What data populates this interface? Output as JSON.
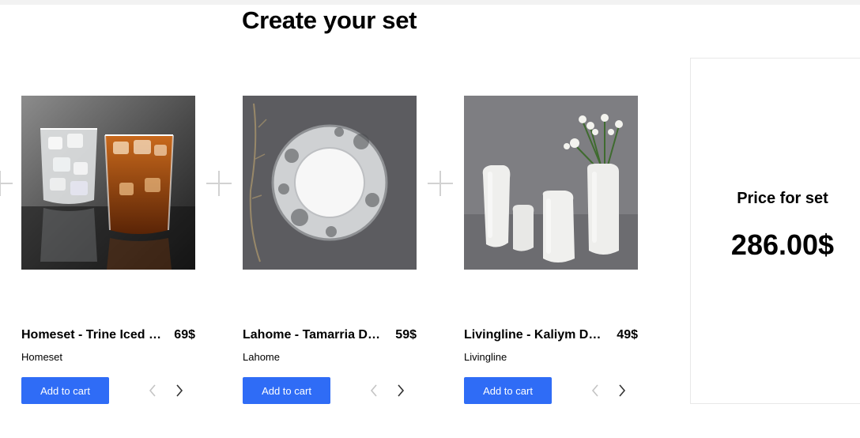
{
  "page": {
    "title": "Create your set"
  },
  "products": [
    {
      "name": "Homeset - Trine Iced …",
      "price": "69$",
      "brand": "Homeset",
      "add_to_cart": "Add to cart",
      "image_icon": "glassware-image"
    },
    {
      "name": "Lahome - Tamarria De…",
      "price": "59$",
      "brand": "Lahome",
      "add_to_cart": "Add to cart",
      "image_icon": "plate-image"
    },
    {
      "name": "Livingline - Kaliym De…",
      "price": "49$",
      "brand": "Livingline",
      "add_to_cart": "Add to cart",
      "image_icon": "vases-image"
    }
  ],
  "summary": {
    "label": "Price for set",
    "total": "286.00$"
  },
  "colors": {
    "accent": "#2f6cf6",
    "separator": "#d2d2d2",
    "arrow": "#333333",
    "arrow_disabled": "#c4c4c4"
  },
  "icons": {
    "separator": "plus-icon",
    "prev": "chevron-left-icon",
    "next": "chevron-right-icon"
  }
}
